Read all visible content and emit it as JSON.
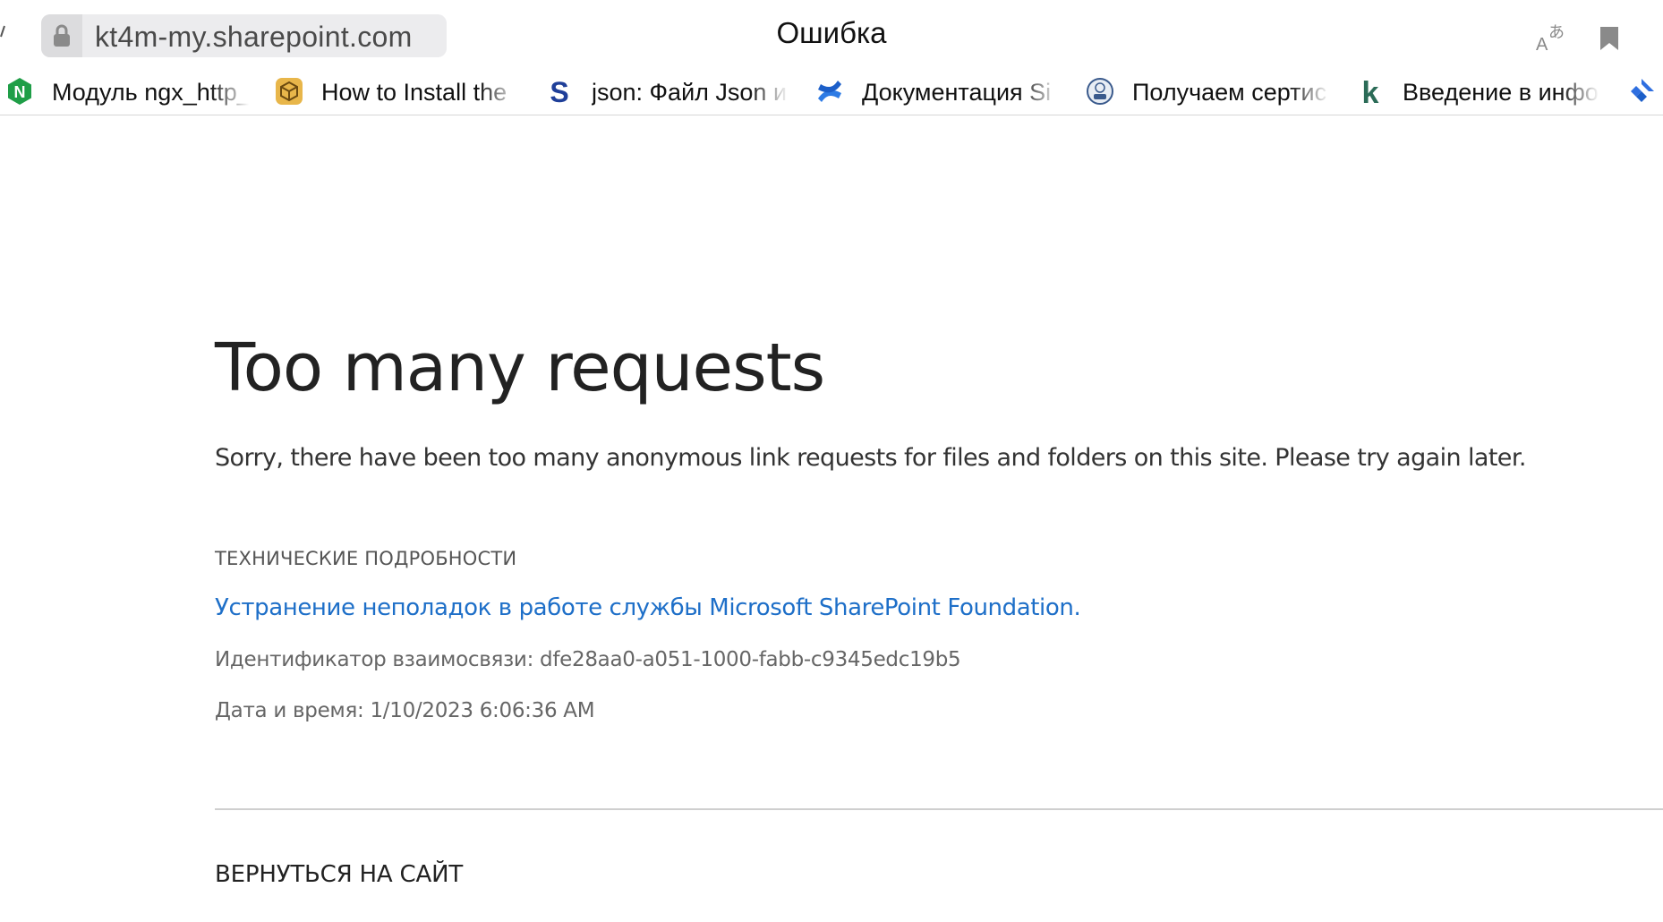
{
  "browser": {
    "url": "kt4m-my.sharepoint.com",
    "tab_title": "Ошибка",
    "icons": [
      "lock-icon",
      "translate-icon",
      "bookmark-icon"
    ]
  },
  "bookmarks": [
    {
      "label": "Модуль ngx_http_",
      "icon": "nginx-icon",
      "color": "#1f9e47"
    },
    {
      "label": "How to Install the",
      "icon": "box-icon",
      "color": "#e8b64a"
    },
    {
      "label": "json: Файл Json и",
      "icon": "s-letter-icon",
      "color": "#1f3f99"
    },
    {
      "label": "Документация Si",
      "icon": "confluence-icon",
      "color": "#2d7be5"
    },
    {
      "label": "Получаем сертис",
      "icon": "globe-badge-icon",
      "color": "#3a5a8c"
    },
    {
      "label": "Введение в инфо",
      "icon": "k-letter-icon",
      "color": "#2b6b57"
    },
    {
      "label": "",
      "icon": "jira-icon",
      "color": "#2f6fe0"
    }
  ],
  "error": {
    "heading": "Too many requests",
    "message": "Sorry, there have been too many anonymous link requests for files and folders on this site. Please try again later.",
    "technical_label": "ТЕХНИЧЕСКИЕ ПОДРОБНОСТИ",
    "help_link": "Устранение неполадок в работе службы Microsoft SharePoint Foundation.",
    "correlation_id": "Идентификатор взаимосвязи: dfe28aa0-a051-1000-fabb-c9345edc19b5",
    "datetime": "Дата и время: 1/10/2023 6:06:36 AM",
    "return_link": "ВЕРНУТЬСЯ НА САЙТ",
    "link_color": "#1e6fc8"
  }
}
